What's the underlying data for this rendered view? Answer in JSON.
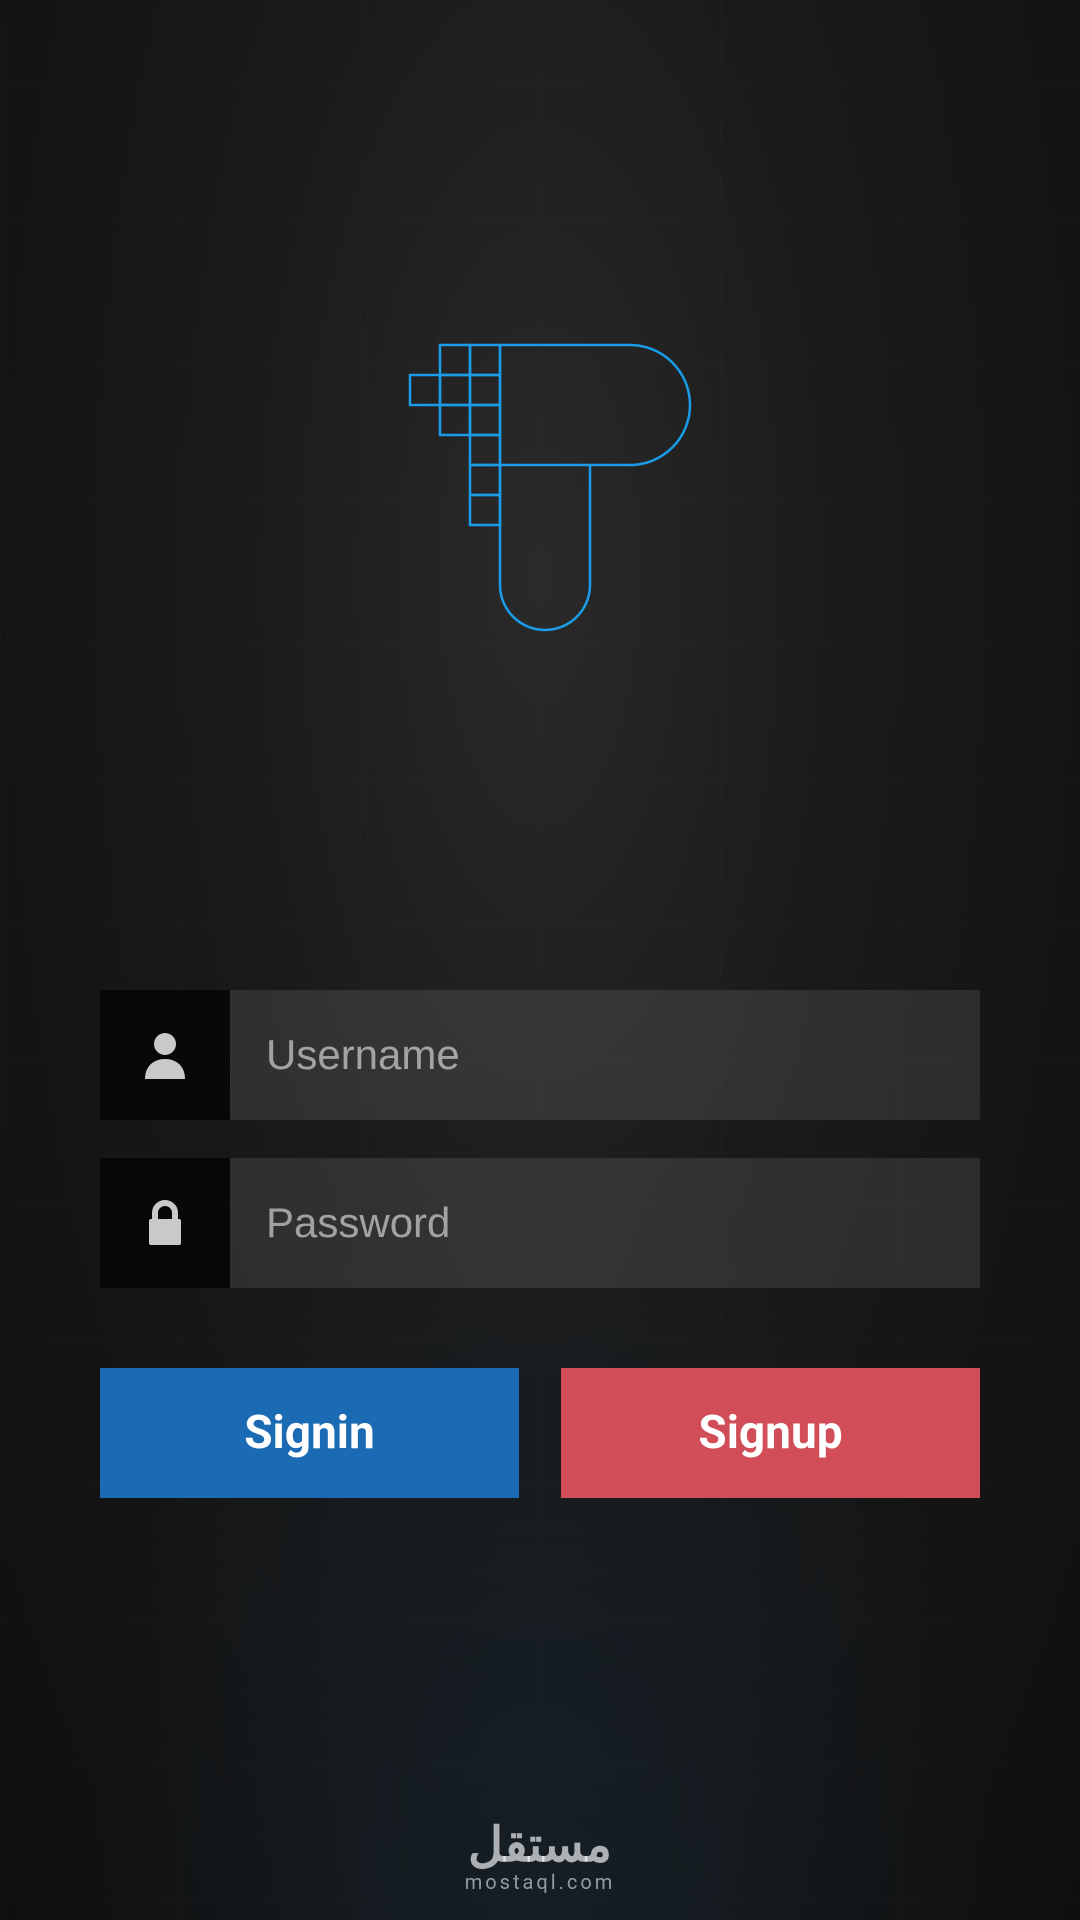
{
  "colors": {
    "accent_blue": "#1a9ce8",
    "button_blue": "#1a6bb3",
    "button_red": "#d14d57"
  },
  "form": {
    "username": {
      "placeholder": "Username",
      "value": "",
      "icon": "user-icon"
    },
    "password": {
      "placeholder": "Password",
      "value": "",
      "icon": "lock-icon"
    }
  },
  "buttons": {
    "signin": "Signin",
    "signup": "Signup"
  },
  "footer": {
    "brand_ar": "مستقل",
    "brand_en": "mostaql.com"
  }
}
